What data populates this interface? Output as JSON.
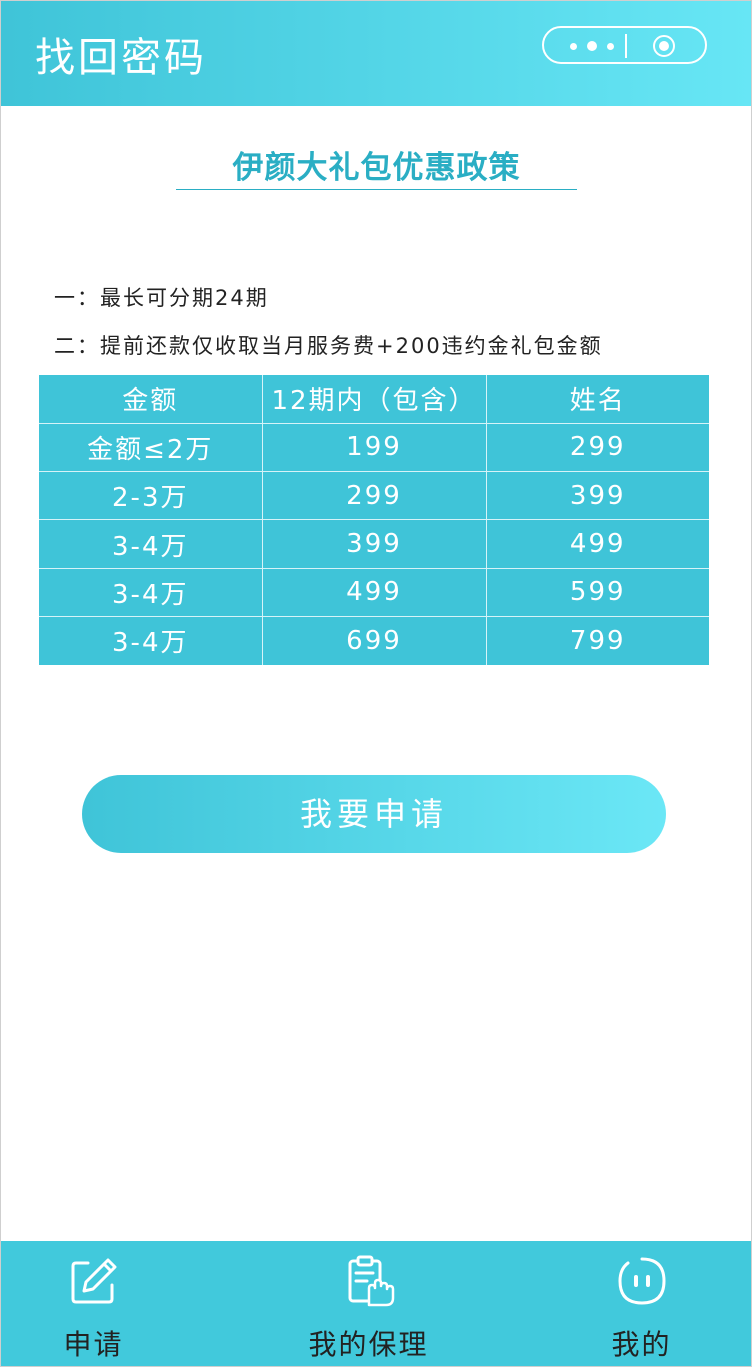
{
  "header": {
    "title": "找回密码"
  },
  "policy": {
    "title": "伊颜大礼包优惠政策",
    "line1": "一：最长可分期24期",
    "line2": "二：提前还款仅收取当月服务费+200违约金礼包金额"
  },
  "table": {
    "headers": [
      "金额",
      "12期内（包含）",
      "姓名"
    ],
    "rows": [
      [
        "金额≤2万",
        "199",
        "299"
      ],
      [
        "2-3万",
        "299",
        "399"
      ],
      [
        "3-4万",
        "399",
        "499"
      ],
      [
        "3-4万",
        "499",
        "599"
      ],
      [
        "3-4万",
        "699",
        "799"
      ]
    ]
  },
  "apply_button": {
    "label": "我要申请"
  },
  "tabbar": {
    "items": [
      {
        "label": "申请",
        "icon": "edit-icon"
      },
      {
        "label": "我的保理",
        "icon": "clipboard-hand-icon"
      },
      {
        "label": "我的",
        "icon": "face-icon"
      }
    ]
  },
  "colors": {
    "accent": "#3fc4d8",
    "accent_light": "#67e6f5",
    "title_text": "#2aaec4"
  }
}
